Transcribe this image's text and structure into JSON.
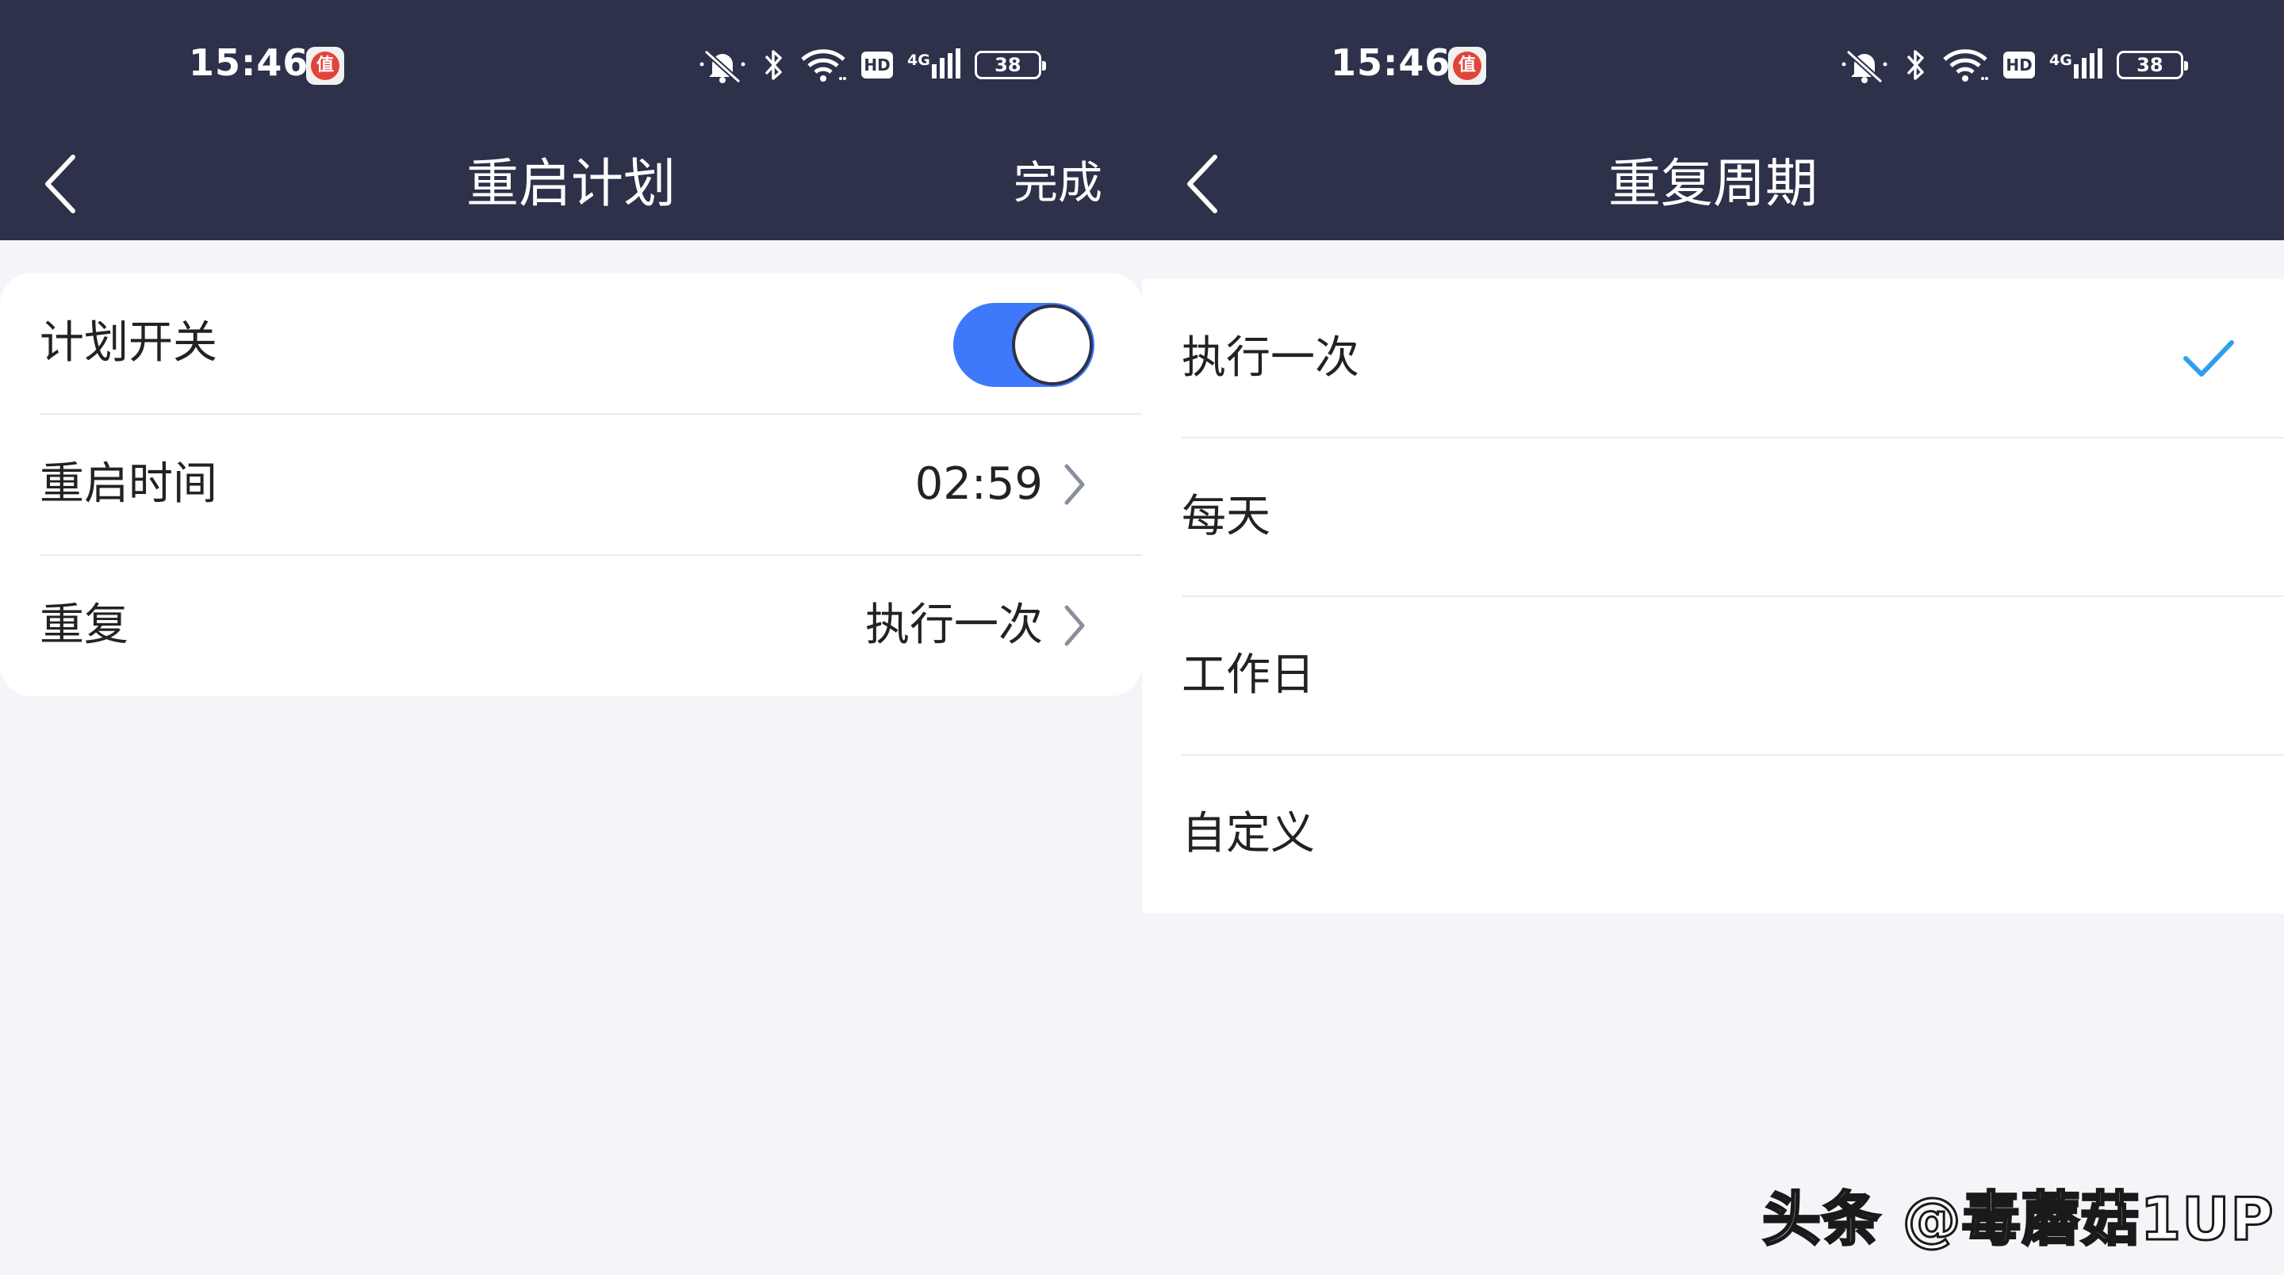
{
  "left": {
    "status": {
      "time": "15:46",
      "app_badge": "值",
      "network_label": "4G",
      "battery": "38",
      "hd": "HD"
    },
    "nav": {
      "title": "重启计划",
      "action": "完成"
    },
    "rows": [
      {
        "label": "计划开关",
        "toggle_on": true
      },
      {
        "label": "重启时间",
        "value": "02:59"
      },
      {
        "label": "重复",
        "value": "执行一次"
      }
    ]
  },
  "right": {
    "status": {
      "time": "15:46",
      "app_badge": "值",
      "network_label": "4G",
      "battery": "38",
      "hd": "HD"
    },
    "nav": {
      "title": "重复周期"
    },
    "options": [
      {
        "label": "执行一次",
        "selected": true
      },
      {
        "label": "每天",
        "selected": false
      },
      {
        "label": "工作日",
        "selected": false
      },
      {
        "label": "自定义",
        "selected": false
      }
    ]
  },
  "watermark": "头条 @毒蘑菇1UP",
  "colors": {
    "header_bg": "#2d3149",
    "accent_toggle": "#3d79fa",
    "checkmark": "#2f9ef0",
    "page_bg": "#f4f5f9"
  },
  "icons": [
    "mute-icon",
    "bluetooth-icon",
    "wifi-icon",
    "hd-icon",
    "signal-icon",
    "battery-icon",
    "back-arrow-icon",
    "chevron-right-icon",
    "checkmark-icon"
  ]
}
